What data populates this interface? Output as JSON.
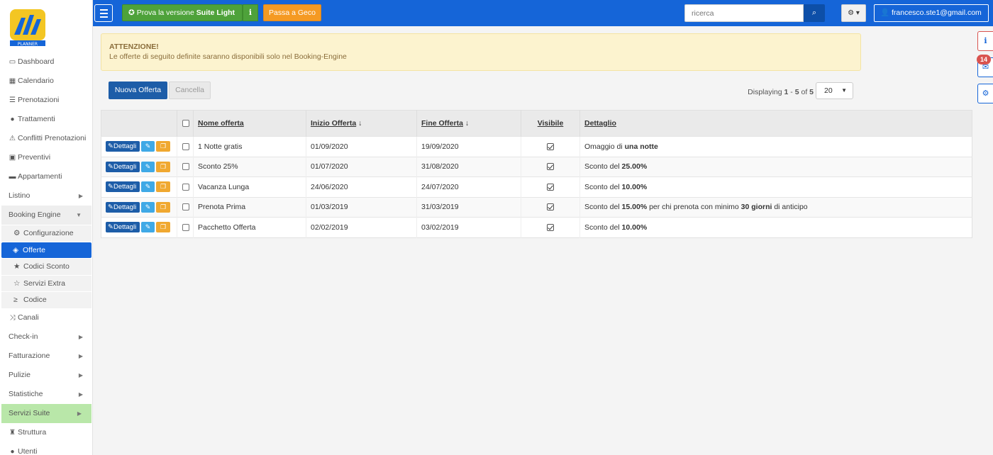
{
  "topbar": {
    "menu_icon": "hamburger-icon",
    "suite_light_prefix": "Prova la versione ",
    "suite_light_bold": "Suite Light",
    "geco_label": "Passa a Geco",
    "search_placeholder": "ricerca",
    "user_email": "francesco.ste1@gmail.com",
    "accent_color": "#1565d8"
  },
  "sidebar": {
    "logo_text": "PLANNER",
    "items": [
      {
        "label": "Dashboard",
        "icon": "monitor-icon"
      },
      {
        "label": "Calendario",
        "icon": "calendar-icon"
      },
      {
        "label": "Prenotazioni",
        "icon": "list-icon"
      },
      {
        "label": "Trattamenti",
        "icon": "apple-icon"
      },
      {
        "label": "Conflitti Prenotazioni",
        "icon": "warning-icon"
      },
      {
        "label": "Preventivi",
        "icon": "calculator-icon"
      },
      {
        "label": "Appartamenti",
        "icon": "bed-icon"
      },
      {
        "label": "Listino"
      },
      {
        "label": "Booking Engine"
      }
    ],
    "booking_sub": [
      {
        "label": "Configurazione",
        "icon": "gear-icon"
      },
      {
        "label": "Offerte",
        "icon": "tags-icon"
      },
      {
        "label": "Codici Sconto",
        "icon": "star-icon"
      },
      {
        "label": "Servizi Extra",
        "icon": "star-outline-icon"
      },
      {
        "label": "Codice",
        "icon": "terminal-icon"
      }
    ],
    "items_after": [
      {
        "label": "Canali",
        "icon": "shuffle-icon"
      },
      {
        "label": "Check-in"
      },
      {
        "label": "Fatturazione"
      },
      {
        "label": "Pulizie"
      },
      {
        "label": "Statistiche"
      },
      {
        "label": "Servizi Suite"
      },
      {
        "label": "Struttura",
        "icon": "building-icon"
      },
      {
        "label": "Utenti",
        "icon": "user-icon"
      }
    ]
  },
  "notifications": {
    "count": "14"
  },
  "alert": {
    "title": "ATTENZIONE!",
    "text": "Le offerte di seguito definite saranno disponibili solo nel Booking-Engine"
  },
  "actions": {
    "new_label": "Nuova Offerta",
    "delete_label": "Cancella"
  },
  "pagination": {
    "prefix": "Displaying ",
    "from": "1",
    "sep": " - ",
    "to": "5",
    "of": " of ",
    "total": "5",
    "per_page": "20"
  },
  "table": {
    "headers": {
      "name": "Nome offerta",
      "start": "Inizio Offerta",
      "end": "Fine Offerta",
      "visible": "Visibile",
      "detail": "Dettaglio"
    },
    "row_button_label": "Dettagli",
    "rows": [
      {
        "name": "1 Notte gratis",
        "start": "01/09/2020",
        "end": "19/09/2020",
        "visible": true,
        "detail_pre": "Omaggio di ",
        "detail_bold": "una notte",
        "detail_mid": "",
        "detail_bold2": "",
        "detail_post": ""
      },
      {
        "name": "Sconto 25%",
        "start": "01/07/2020",
        "end": "31/08/2020",
        "visible": true,
        "detail_pre": "Sconto del ",
        "detail_bold": "25.00%",
        "detail_mid": "",
        "detail_bold2": "",
        "detail_post": ""
      },
      {
        "name": "Vacanza Lunga",
        "start": "24/06/2020",
        "end": "24/07/2020",
        "visible": true,
        "detail_pre": "Sconto del ",
        "detail_bold": "10.00%",
        "detail_mid": "",
        "detail_bold2": "",
        "detail_post": ""
      },
      {
        "name": "Prenota Prima",
        "start": "01/03/2019",
        "end": "31/03/2019",
        "visible": true,
        "detail_pre": "Sconto del ",
        "detail_bold": "15.00%",
        "detail_mid": " per chi prenota con minimo ",
        "detail_bold2": "30 giorni",
        "detail_post": " di anticipo"
      },
      {
        "name": "Pacchetto Offerta",
        "start": "02/02/2019",
        "end": "03/02/2019",
        "visible": true,
        "detail_pre": "Sconto del ",
        "detail_bold": "10.00%",
        "detail_mid": "",
        "detail_bold2": "",
        "detail_post": ""
      }
    ]
  }
}
